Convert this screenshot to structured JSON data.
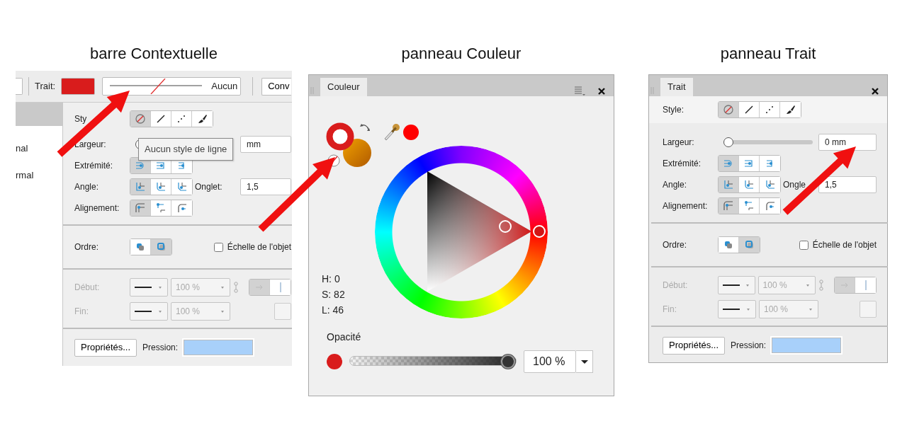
{
  "context_bar": {
    "caption": "barre Contextuelle",
    "stroke_label": "Trait:",
    "stroke_style_text": "Aucun",
    "convert_button": "Conv",
    "sidebar_texts": [
      "nal",
      "rmal"
    ],
    "tooltip": "Aucun style de ligne",
    "popup": {
      "style_label": "Sty",
      "styles": [
        {
          "kind": "none",
          "selected": true
        },
        {
          "kind": "solid",
          "selected": false
        },
        {
          "kind": "dashed",
          "selected": false
        },
        {
          "kind": "brush",
          "selected": false
        }
      ],
      "width_label": "Largeur:",
      "width_value": "mm",
      "cap_label": "Extrémité:",
      "caps": [
        {
          "kind": "round",
          "selected": true
        },
        {
          "kind": "square",
          "selected": false
        },
        {
          "kind": "butt",
          "selected": false
        }
      ],
      "join_label": "Angle:",
      "joins": [
        {
          "kind": "miter",
          "selected": true
        },
        {
          "kind": "round",
          "selected": false
        },
        {
          "kind": "bevel",
          "selected": false
        }
      ],
      "miter_label": "Onglet:",
      "miter_value": "1,5",
      "align_label": "Alignement:",
      "aligns": [
        {
          "kind": "inside",
          "selected": true
        },
        {
          "kind": "center",
          "selected": false
        },
        {
          "kind": "outside",
          "selected": false
        }
      ],
      "order_label": "Ordre:",
      "orders": [
        {
          "kind": "behind",
          "selected": false
        },
        {
          "kind": "front",
          "selected": true
        }
      ],
      "scale_label": "Échelle de l'objet",
      "scale_checked": false,
      "start_label": "Début:",
      "end_label": "Fin:",
      "arrows_disabled": true,
      "start_size": "100 %",
      "end_size": "100 %",
      "arrow_positions": [
        {
          "kind": "inside",
          "selected": true
        },
        {
          "kind": "outside",
          "selected": false
        }
      ],
      "properties_button": "Propriétés...",
      "pressure_label": "Pression:"
    }
  },
  "color_panel": {
    "caption": "panneau Couleur",
    "tab": "Couleur",
    "hsl": [
      "H: 0",
      "S: 82",
      "L: 46"
    ],
    "opacity_label": "Opacité",
    "opacity_slider": {
      "level": 1
    },
    "opacity_value": "100 %"
  },
  "stroke_panel": {
    "caption": "panneau Trait",
    "tab": "Trait",
    "body": {
      "style_label": "Style:",
      "styles": [
        {
          "kind": "none",
          "selected": true
        },
        {
          "kind": "solid",
          "selected": false
        },
        {
          "kind": "dashed",
          "selected": false
        },
        {
          "kind": "brush",
          "selected": false
        }
      ],
      "width_label": "Largeur:",
      "width_slider": {
        "level": 0
      },
      "width_value": "0 mm",
      "cap_label": "Extrémité:",
      "caps": [
        {
          "kind": "round",
          "selected": true
        },
        {
          "kind": "square",
          "selected": false
        },
        {
          "kind": "butt",
          "selected": false
        }
      ],
      "join_label": "Angle:",
      "joins": [
        {
          "kind": "miter",
          "selected": true
        },
        {
          "kind": "round",
          "selected": false
        },
        {
          "kind": "bevel",
          "selected": false
        }
      ],
      "miter_label": "Ongle",
      "miter_value": "1,5",
      "align_label": "Alignement:",
      "aligns": [
        {
          "kind": "inside",
          "selected": true
        },
        {
          "kind": "center",
          "selected": false
        },
        {
          "kind": "outside",
          "selected": false
        }
      ],
      "order_label": "Ordre:",
      "orders": [
        {
          "kind": "behind",
          "selected": false
        },
        {
          "kind": "front",
          "selected": true
        }
      ],
      "scale_label": "Échelle de l'objet",
      "scale_checked": false,
      "start_label": "Début:",
      "end_label": "Fin:",
      "arrows_disabled": true,
      "start_size": "100 %",
      "end_size": "100 %",
      "arrow_positions": [
        {
          "kind": "inside",
          "selected": true
        },
        {
          "kind": "outside",
          "selected": false
        }
      ],
      "properties_button": "Propriétés...",
      "pressure_label": "Pression:"
    }
  }
}
